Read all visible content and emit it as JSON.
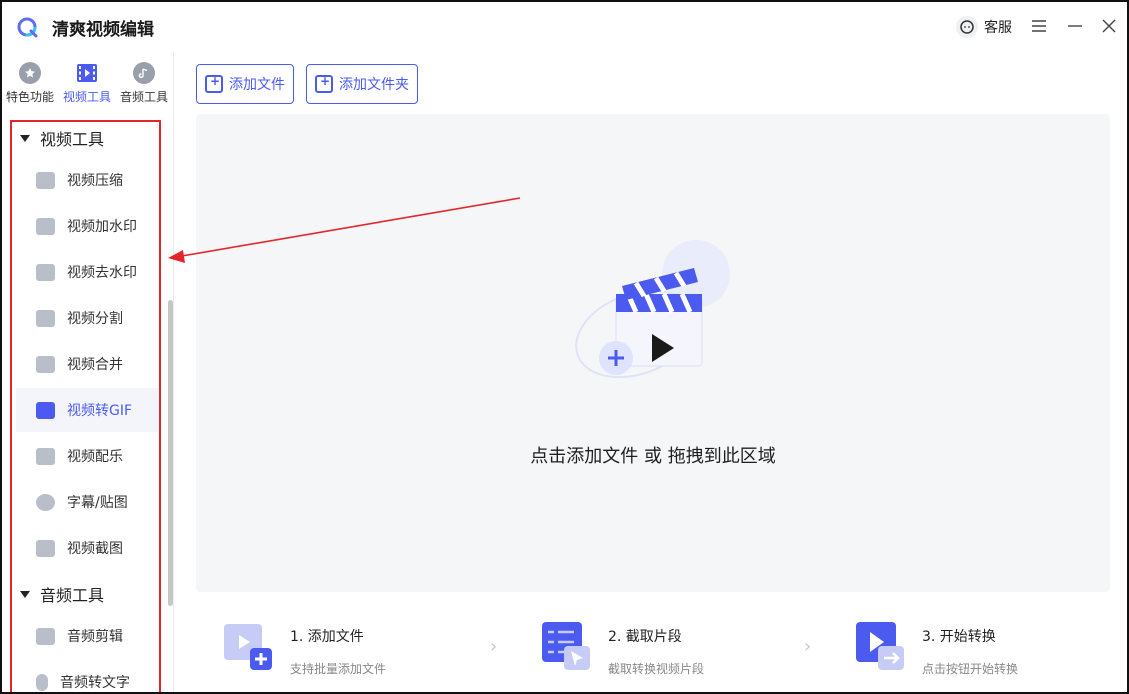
{
  "app": {
    "title": "清爽视频编辑"
  },
  "header": {
    "service_label": "客服"
  },
  "top_tabs": [
    {
      "label": "特色功能",
      "icon": "star-icon"
    },
    {
      "label": "视频工具",
      "icon": "video-icon"
    },
    {
      "label": "音频工具",
      "icon": "music-icon"
    }
  ],
  "sidebar": {
    "video_section": "视频工具",
    "video_items": [
      "视频压缩",
      "视频加水印",
      "视频去水印",
      "视频分割",
      "视频合并",
      "视频转GIF",
      "视频配乐",
      "字幕/贴图",
      "视频截图"
    ],
    "active_item": "视频转GIF",
    "audio_section": "音频工具",
    "audio_items": [
      "音频剪辑",
      "音频转文字"
    ]
  },
  "toolbar": {
    "add_file": "添加文件",
    "add_folder": "添加文件夹"
  },
  "dropzone": {
    "text": "点击添加文件 或 拖拽到此区域"
  },
  "steps": [
    {
      "title": "1. 添加文件",
      "desc": "支持批量添加文件"
    },
    {
      "title": "2. 截取片段",
      "desc": "截取转换视频片段"
    },
    {
      "title": "3. 开始转换",
      "desc": "点击按钮开始转换"
    }
  ],
  "colors": {
    "accent": "#4b5bf0",
    "highlight": "#e3262b"
  }
}
